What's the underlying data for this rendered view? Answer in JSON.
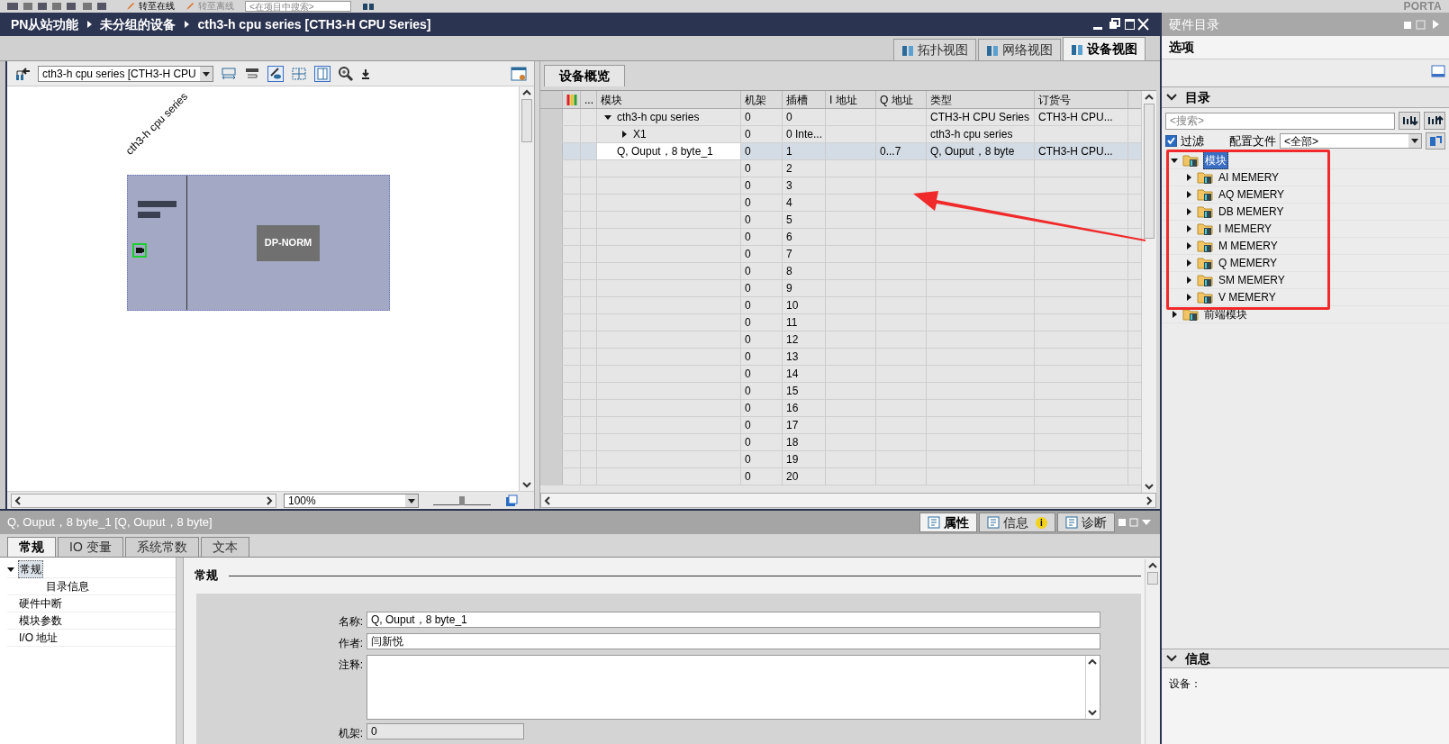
{
  "toolbar": {
    "buttons": [
      "转至在线",
      "转至离线"
    ],
    "search": {
      "placeholder": "<在项目中搜索>"
    },
    "brand": "PORTA"
  },
  "breadcrumb": [
    "PN从站功能",
    "未分组的设备",
    "cth3-h cpu series [CTH3-H CPU Series]"
  ],
  "view_tabs": [
    {
      "label": "拓扑视图",
      "selected": false
    },
    {
      "label": "网络视图",
      "selected": false
    },
    {
      "label": "设备视图",
      "selected": true
    }
  ],
  "device_view": {
    "device_select": "cth3-h cpu series [CTH3-H CPU",
    "device_label": "cth3-h cpu series",
    "module_label": "DP-NORM",
    "zoom": "100%",
    "zoom_slider": {
      "level": 0.5
    }
  },
  "overview": {
    "tab": "设备概览",
    "columns": [
      "...",
      "模块",
      "机架",
      "插槽",
      "I 地址",
      "Q 地址",
      "类型",
      "订货号"
    ],
    "rows": [
      {
        "module": "cth3-h cpu series",
        "rack": "0",
        "slot": "0",
        "type": "CTH3-H CPU Series",
        "order_no": "CTH3-H CPU...",
        "selected": false,
        "expanded": true,
        "children": [
          {
            "module": "X1",
            "rack": "0",
            "slot": "0 Inte...",
            "type": "cth3-h cpu series",
            "selected": false,
            "expanded": false
          }
        ]
      },
      {
        "module": "Q, Ouput，8 byte_1",
        "rack": "0",
        "slot": "1",
        "q_address": "0...7",
        "type": "Q, Ouput，8 byte",
        "order_no": "CTH3-H CPU...",
        "selected": true
      },
      {
        "rack": "0",
        "slot": "2",
        "selected": false
      },
      {
        "rack": "0",
        "slot": "3",
        "selected": false
      },
      {
        "rack": "0",
        "slot": "4",
        "selected": false
      },
      {
        "rack": "0",
        "slot": "5",
        "selected": false
      },
      {
        "rack": "0",
        "slot": "6",
        "selected": false
      },
      {
        "rack": "0",
        "slot": "7",
        "selected": false
      },
      {
        "rack": "0",
        "slot": "8",
        "selected": false
      },
      {
        "rack": "0",
        "slot": "9",
        "selected": false
      },
      {
        "rack": "0",
        "slot": "10",
        "selected": false
      },
      {
        "rack": "0",
        "slot": "11",
        "selected": false
      },
      {
        "rack": "0",
        "slot": "12",
        "selected": false
      },
      {
        "rack": "0",
        "slot": "13",
        "selected": false
      },
      {
        "rack": "0",
        "slot": "14",
        "selected": false
      },
      {
        "rack": "0",
        "slot": "15",
        "selected": false
      },
      {
        "rack": "0",
        "slot": "16",
        "selected": false
      },
      {
        "rack": "0",
        "slot": "17",
        "selected": false
      },
      {
        "rack": "0",
        "slot": "18",
        "selected": false
      },
      {
        "rack": "0",
        "slot": "19",
        "selected": false
      },
      {
        "rack": "0",
        "slot": "20",
        "selected": false
      }
    ]
  },
  "properties": {
    "title": "Q, Ouput，8 byte_1 [Q, Ouput，8 byte]",
    "tabs": [
      {
        "label": "属性",
        "selected": true
      },
      {
        "label": "信息",
        "selected": false,
        "badge": "i"
      },
      {
        "label": "诊断",
        "selected": false
      }
    ],
    "subtabs": [
      {
        "label": "常规",
        "selected": true
      },
      {
        "label": "IO 变量",
        "selected": false
      },
      {
        "label": "系统常数",
        "selected": false
      },
      {
        "label": "文本",
        "selected": false
      }
    ],
    "nav": [
      {
        "label": "常规",
        "selected": true,
        "expanded": true,
        "children": [
          {
            "label": "目录信息",
            "selected": false
          }
        ]
      },
      {
        "label": "硬件中断",
        "selected": false
      },
      {
        "label": "模块参数",
        "selected": false
      },
      {
        "label": "I/O 地址",
        "selected": false
      }
    ],
    "section": "常规",
    "fields": [
      {
        "kind": "text",
        "label": "名称:",
        "value": "Q, Ouput，8 byte_1"
      },
      {
        "kind": "text",
        "label": "作者:",
        "value": "闫新悦"
      },
      {
        "kind": "textarea",
        "label": "注释:"
      },
      {
        "kind": "short",
        "label": "机架:",
        "value": "0"
      }
    ]
  },
  "catalog": {
    "title": "硬件目录",
    "options": "选项",
    "section": "目录",
    "search": {
      "placeholder": "<搜索>"
    },
    "filter": {
      "label": "过滤",
      "checked": true
    },
    "profile_label": "配置文件",
    "profile": "<全部>",
    "tree": [
      {
        "label": "模块",
        "selected": true,
        "expanded": true,
        "children": [
          {
            "label": "AI MEMERY",
            "selected": false,
            "expanded": false
          },
          {
            "label": "AQ MEMERY",
            "selected": false,
            "expanded": false
          },
          {
            "label": "DB MEMERY",
            "selected": false,
            "expanded": false
          },
          {
            "label": "I MEMERY",
            "selected": false,
            "expanded": false
          },
          {
            "label": "M MEMERY",
            "selected": false,
            "expanded": false
          },
          {
            "label": "Q MEMERY",
            "selected": false,
            "expanded": false
          },
          {
            "label": "SM MEMERY",
            "selected": false,
            "expanded": false
          },
          {
            "label": "V MEMERY",
            "selected": false,
            "expanded": false
          }
        ]
      },
      {
        "label": "前端模块",
        "selected": false,
        "expanded": false
      }
    ]
  },
  "info": {
    "title": "信息",
    "device_label": "设备："
  }
}
